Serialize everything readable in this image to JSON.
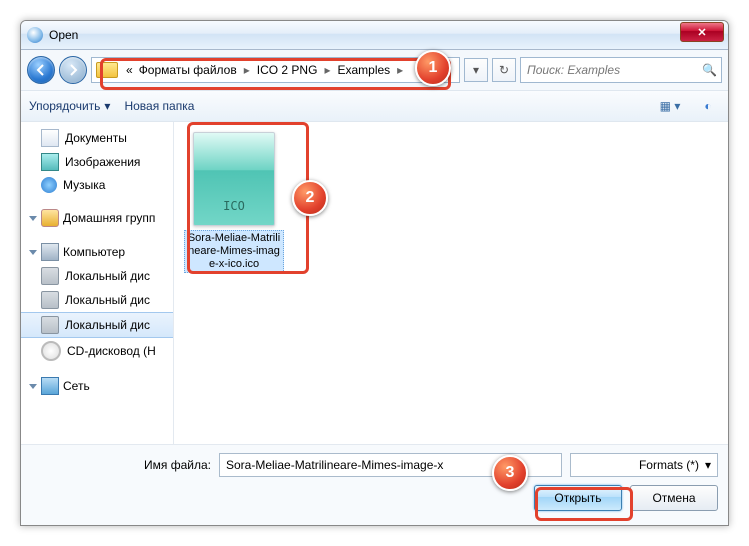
{
  "window": {
    "title": "Open"
  },
  "breadcrumb": {
    "prefix": "«",
    "seg1": "Форматы файлов",
    "seg2": "ICO 2 PNG",
    "seg3": "Examples"
  },
  "search": {
    "placeholder": "Поиск: Examples"
  },
  "toolbar": {
    "organize": "Упорядочить",
    "newfolder": "Новая папка"
  },
  "sidebar": {
    "items": [
      {
        "label": "Документы",
        "icon": "doc"
      },
      {
        "label": "Изображения",
        "icon": "pic"
      },
      {
        "label": "Музыка",
        "icon": "mus"
      }
    ],
    "homegroup": {
      "label": "Домашняя групп"
    },
    "computer": {
      "label": "Компьютер"
    },
    "drives": [
      {
        "label": "Локальный дис"
      },
      {
        "label": "Локальный дис"
      },
      {
        "label": "Локальный дис"
      }
    ],
    "cd": {
      "label": "CD-дисковод (H"
    },
    "network": {
      "label": "Сеть"
    }
  },
  "file": {
    "thumb_text": "ICO",
    "name": "Sora-Meliae-Matrilineare-Mimes-image-x-ico.ico"
  },
  "footer": {
    "filename_label": "Имя файла:",
    "filename_value": "Sora-Meliae-Matrilineare-Mimes-image-x",
    "filter_suffix": "Formats (*)",
    "open": "Открыть",
    "cancel": "Отмена"
  },
  "badges": {
    "b1": "1",
    "b2": "2",
    "b3": "3"
  }
}
